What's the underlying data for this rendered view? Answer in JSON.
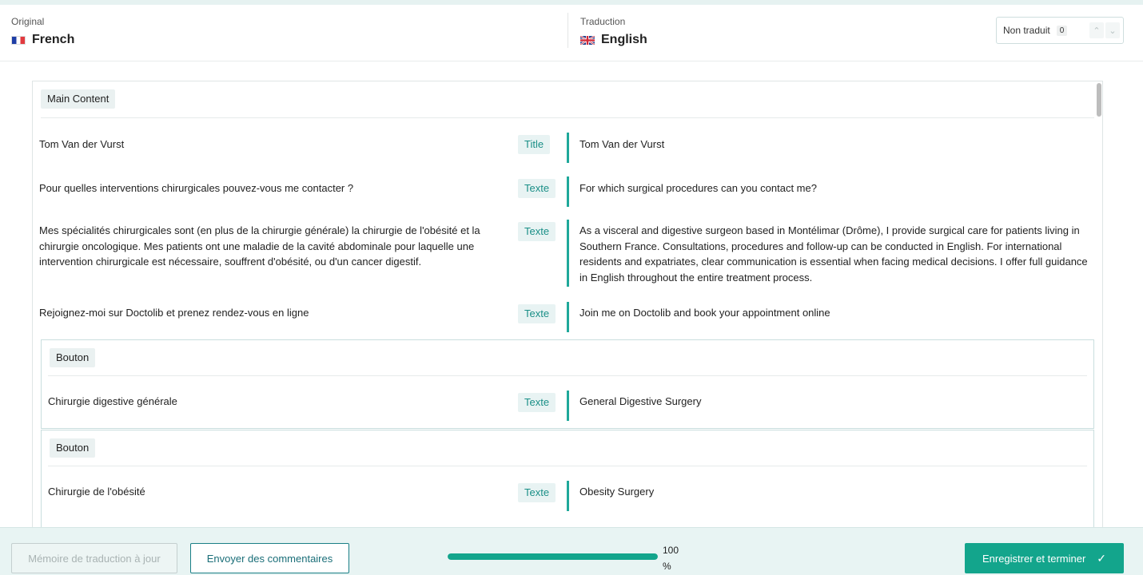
{
  "header": {
    "original_caption": "Original",
    "original_language": "French",
    "original_flag": "flag-fr-icon",
    "translation_caption": "Traduction",
    "translation_language": "English",
    "translation_flag": "flag-uk-icon",
    "untranslated_label": "Non traduit",
    "untranslated_count": "0"
  },
  "section": {
    "label": "Main Content"
  },
  "rows": [
    {
      "source": "Tom Van der Vurst",
      "type": "Title",
      "target": "Tom Van der Vurst"
    },
    {
      "source": "Pour quelles interventions chirurgicales pouvez-vous me contacter ?",
      "type": "Texte",
      "target": "For which surgical procedures can you contact me?"
    },
    {
      "source": "Mes spécialités chirurgicales sont (en plus de la chirurgie générale) la chirurgie de l'obésité et la chirurgie oncologique. Mes patients ont une maladie de la cavité abdominale pour laquelle une intervention chirurgicale est nécessaire, souffrent d'obésité, ou d'un cancer digestif.",
      "type": "Texte",
      "target": "As a visceral and digestive surgeon based in Montélimar (Drôme), I provide surgical care for patients living in Southern France. Consultations, procedures and follow-up can be conducted in English. For international residents and expatriates, clear communication is essential when facing medical decisions. I offer full guidance in English throughout the entire treatment process."
    },
    {
      "source": "Rejoignez-moi sur Doctolib et prenez rendez-vous en ligne",
      "type": "Texte",
      "target": "Join me on Doctolib and book your appointment online"
    }
  ],
  "buttons": [
    {
      "label": "Bouton",
      "source": "Chirurgie digestive générale",
      "type": "Texte",
      "target": "General Digestive Surgery"
    },
    {
      "label": "Bouton",
      "source": "Chirurgie de l'obésité",
      "type": "Texte",
      "target": "Obesity Surgery"
    }
  ],
  "footer": {
    "memory_button": "Mémoire de traduction à jour",
    "comments_button": "Envoyer des commentaires",
    "progress_value": "100",
    "progress_unit": "%",
    "progress_fraction": 1.0,
    "save_button": "Enregistrer et terminer"
  },
  "colors": {
    "accent": "#13a58c",
    "accent_dark": "#1a7f86"
  }
}
